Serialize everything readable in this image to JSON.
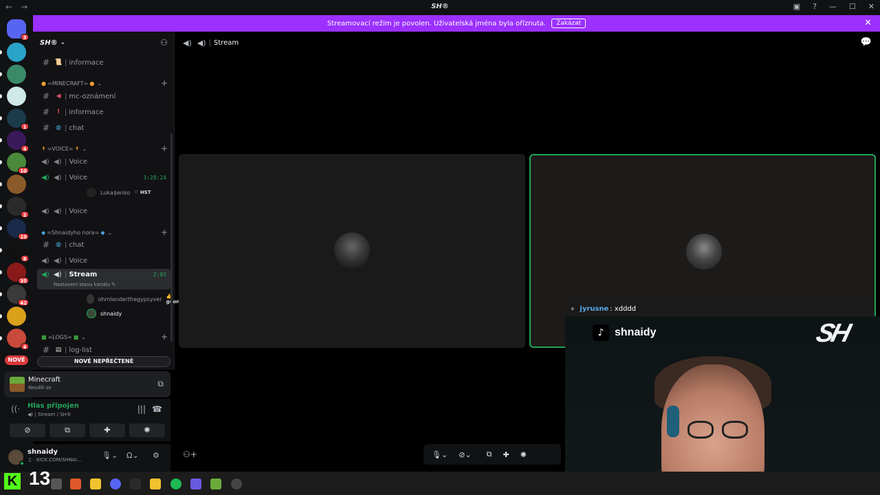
{
  "window": {
    "title": "SH®"
  },
  "banner": {
    "text": "Streamovací režim je povolen. Uživatelská jména byla oříznuta.",
    "disable_label": "Zakázat",
    "bg_color": "#9b30ff"
  },
  "guilds": [
    {
      "badge": "3",
      "color": "#5865f2"
    },
    {
      "badge": "",
      "color": "#29a4c8"
    },
    {
      "badge": "",
      "color": "#3a8a6a"
    },
    {
      "badge": "",
      "color": "#cfe8e8"
    },
    {
      "badge": "1",
      "color": "#1b3a4a"
    },
    {
      "badge": "4",
      "color": "#3a1a5a"
    },
    {
      "badge": "10",
      "color": "#4a8a3a"
    },
    {
      "badge": "",
      "color": "#8a5a2a"
    },
    {
      "badge": "2",
      "color": "#2a2a2a"
    },
    {
      "badge": "19",
      "color": "#1a2a4a"
    },
    {
      "badge": "8",
      "color": "#111111"
    },
    {
      "badge": "35",
      "color": "#8a1a1a"
    },
    {
      "badge": "42",
      "color": "#3a3a3a"
    },
    {
      "badge": "",
      "color": "#d9a01a"
    },
    {
      "badge": "4",
      "color": "#c84a3a"
    }
  ],
  "new_badge": "NOVÉ",
  "server": {
    "name": "SH®"
  },
  "channels": {
    "top_informace": "informace",
    "cat_minecraft": "=MINECRAFT=",
    "mc_oznameni": "mc-oznámení",
    "mc_informace": "informace",
    "mc_chat": "chat",
    "cat_voice": "=VOICE=",
    "voice1": "Voice",
    "voice2": "Voice",
    "voice2_time": "3:28:24",
    "voice2_user": "Luka$enko",
    "voice2_user_tag": "HST",
    "voice3": "Voice",
    "cat_shnaidy": "=Shnaidyho nora=",
    "sn_chat": "chat",
    "sn_voice": "Voice",
    "stream": "Stream",
    "stream_time": "2:03",
    "stream_status": "Nastavení stavu kanálu",
    "stream_user1": "ohmlanderthegypsyver",
    "stream_user1_tag": "goon",
    "stream_user2": "shnaidy",
    "cat_logs": "=LOGS=",
    "log_list": "log-list"
  },
  "unread_label": "NOVÉ NEPŘEČTENÉ",
  "activity": {
    "game": "Minecraft",
    "sub": "Nesdílí se"
  },
  "voice_panel": {
    "title": "Hlas připojen",
    "sub": "Stream / SH®"
  },
  "user_panel": {
    "name": "shnaidy",
    "status": "KICK.COM/SHNAI..."
  },
  "main": {
    "channel": "Stream"
  },
  "overlay": {
    "chat_user": "jyrusne",
    "chat_msg": ": xdddd",
    "tiktok_name": "shnaidy",
    "logo": "SH"
  },
  "taskbar": {
    "kick_logo": "K",
    "counter": "13"
  }
}
